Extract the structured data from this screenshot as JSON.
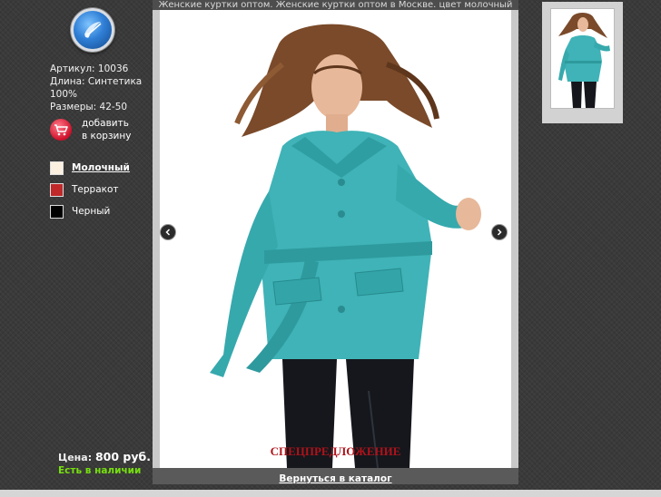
{
  "page": {
    "caption": "Женские куртки оптом. Женские куртки оптом в Москве. цвет молочный"
  },
  "logo": {
    "icon": "logo-icon"
  },
  "product": {
    "article": "Артикул: 10036",
    "length": "Длина: Синтетика",
    "composition": "100%",
    "sizes": "Размеры: 42-50"
  },
  "cart": {
    "icon": "cart-icon",
    "line1": "добавить",
    "line2": "в корзину"
  },
  "colors": [
    {
      "label": "Молочный",
      "hex": "#fbf0e0",
      "selected": true
    },
    {
      "label": "Терракот",
      "hex": "#c0282a",
      "selected": false
    },
    {
      "label": "Черный",
      "hex": "#000000",
      "selected": false
    }
  ],
  "price": {
    "label": "Цена:",
    "value": "800 руб."
  },
  "stock": "Есть в наличии",
  "promo": "СПЕЦПРЕДЛОЖЕНИЕ",
  "return_link": "Вернуться в каталог",
  "accent": {
    "stock_green": "#76e00f",
    "promo_red": "#b0121a",
    "jacket_teal": "#3fb3b7"
  }
}
